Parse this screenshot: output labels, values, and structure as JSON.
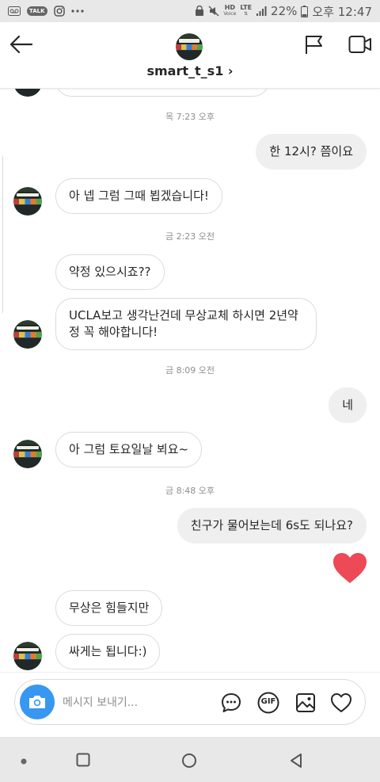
{
  "status_bar": {
    "battery_percent": "22%",
    "time": "오후 12:47",
    "network": "HD",
    "network_sub": "Voice",
    "lte": "LTE"
  },
  "header": {
    "username": "smart_t_s1",
    "chevron": "›"
  },
  "messages": [
    {
      "type": "timestamp",
      "text": "목 7:23 오후"
    },
    {
      "type": "out",
      "text": "한 12시? 쯤이요"
    },
    {
      "type": "in",
      "text": "아 넵 그럼 그때 뵙겠습니다!"
    },
    {
      "type": "timestamp",
      "text": "금 2:23 오전"
    },
    {
      "type": "in",
      "text": "약정 있으시죠??"
    },
    {
      "type": "in",
      "text": "UCLA보고 생각난건데 무상교체 하시면 2년약정 꼭 해야합니다!"
    },
    {
      "type": "timestamp",
      "text": "금 8:09 오전"
    },
    {
      "type": "out",
      "text": "네"
    },
    {
      "type": "in",
      "text": "아 그럼 토요일날 뵈요~"
    },
    {
      "type": "timestamp",
      "text": "금 8:48 오후"
    },
    {
      "type": "out",
      "text": "친구가 물어보는데 6s도 되나요?"
    },
    {
      "type": "reaction",
      "icon": "heart-icon",
      "color": "#ed4956"
    },
    {
      "type": "in",
      "text": "무상은 힘들지만"
    },
    {
      "type": "in",
      "text": "싸게는 됩니다:)"
    }
  ],
  "composer": {
    "placeholder": "메시지 보내기...",
    "gif_label": "GIF"
  },
  "colors": {
    "accent": "#3897f0",
    "heart": "#ed4956",
    "bubble_out": "#efefef",
    "bubble_border": "#dbdbdb"
  }
}
